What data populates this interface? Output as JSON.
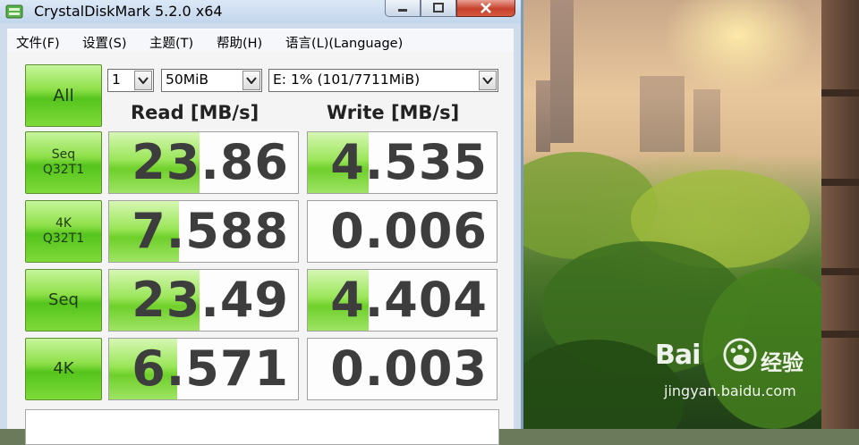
{
  "window": {
    "title": "CrystalDiskMark 5.2.0 x64",
    "controls": {
      "minimize_icon": "minimize-icon",
      "maximize_icon": "maximize-icon",
      "close_icon": "close-icon"
    }
  },
  "menu": {
    "file": "文件(F)",
    "settings": "设置(S)",
    "theme": "主题(T)",
    "help": "帮助(H)",
    "language": "语言(L)(Language)"
  },
  "controls": {
    "all_label": "All",
    "count": "1",
    "size": "50MiB",
    "drive": "E: 1% (101/7711MiB)"
  },
  "headers": {
    "read": "Read [MB/s]",
    "write": "Write [MB/s]"
  },
  "tests": [
    {
      "label_line1": "Seq",
      "label_line2": "Q32T1",
      "read": "23.86",
      "write": "4.535",
      "read_fraction": 0.48,
      "write_fraction": 0.32
    },
    {
      "label_line1": "4K",
      "label_line2": "Q32T1",
      "read": "7.588",
      "write": "0.006",
      "read_fraction": 0.37,
      "write_fraction": 0.0
    },
    {
      "label_line1": "Seq",
      "label_line2": "",
      "read": "23.49",
      "write": "4.404",
      "read_fraction": 0.48,
      "write_fraction": 0.32
    },
    {
      "label_line1": "4K",
      "label_line2": "",
      "read": "6.571",
      "write": "0.003",
      "read_fraction": 0.36,
      "write_fraction": 0.0
    }
  ],
  "watermark": {
    "brand": "Bai",
    "brand_cn": "经验",
    "url": "jingyan.baidu.com"
  },
  "colors": {
    "accent_green": "#6fcf2b",
    "title_bar": "#c2d6ec",
    "close_red": "#c7412c"
  }
}
